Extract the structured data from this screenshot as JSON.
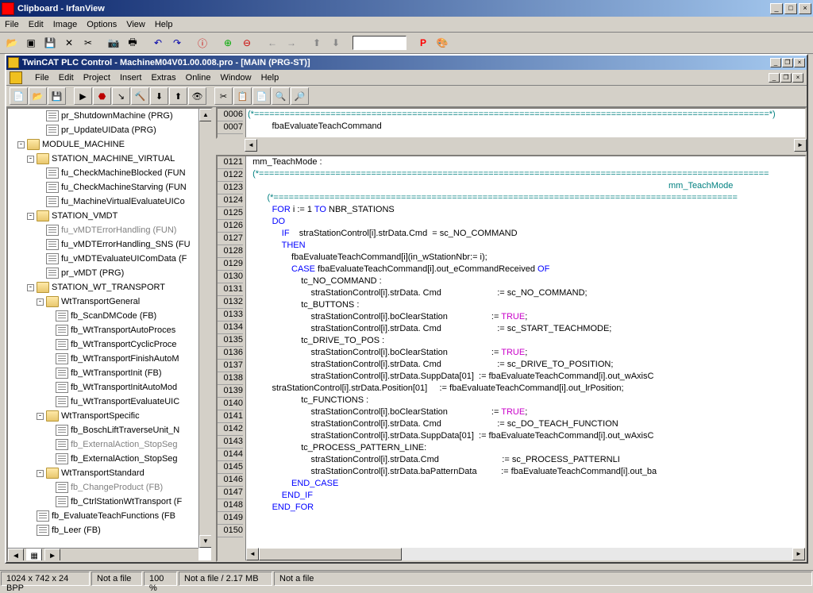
{
  "outer": {
    "title": "Clipboard - IrfanView",
    "menu": [
      "File",
      "Edit",
      "Image",
      "Options",
      "View",
      "Help"
    ]
  },
  "inner": {
    "title": "TwinCAT PLC Control - MachineM04V01.00.008.pro - [MAIN (PRG-ST)]",
    "menu": [
      "File",
      "Edit",
      "Project",
      "Insert",
      "Extras",
      "Online",
      "Window",
      "Help"
    ]
  },
  "tree": [
    {
      "ind": 3,
      "icon": "doc",
      "label": "pr_ShutdownMachine (PRG)"
    },
    {
      "ind": 3,
      "icon": "doc",
      "label": "pr_UpdateUIData (PRG)"
    },
    {
      "ind": 1,
      "exp": "-",
      "icon": "folder-open",
      "label": "MODULE_MACHINE"
    },
    {
      "ind": 2,
      "exp": "-",
      "icon": "folder-open",
      "label": "STATION_MACHINE_VIRTUAL"
    },
    {
      "ind": 3,
      "icon": "doc",
      "label": "fu_CheckMachineBlocked (FUN"
    },
    {
      "ind": 3,
      "icon": "doc",
      "label": "fu_CheckMachineStarving (FUN"
    },
    {
      "ind": 3,
      "icon": "doc",
      "label": "fu_MachineVirtualEvaluateUICo"
    },
    {
      "ind": 2,
      "exp": "-",
      "icon": "folder-open",
      "label": "STATION_VMDT"
    },
    {
      "ind": 3,
      "icon": "doc",
      "label": "fu_vMDTErrorHandling (FUN)",
      "dim": true
    },
    {
      "ind": 3,
      "icon": "doc",
      "label": "fu_vMDTErrorHandling_SNS (FU"
    },
    {
      "ind": 3,
      "icon": "doc",
      "label": "fu_vMDTEvaluateUIComData (F"
    },
    {
      "ind": 3,
      "icon": "doc",
      "label": "pr_vMDT (PRG)"
    },
    {
      "ind": 2,
      "exp": "-",
      "icon": "folder-open",
      "label": "STATION_WT_TRANSPORT"
    },
    {
      "ind": 3,
      "exp": "-",
      "icon": "folder-open",
      "label": "WtTransportGeneral"
    },
    {
      "ind": 4,
      "icon": "doc",
      "label": "fb_ScanDMCode (FB)"
    },
    {
      "ind": 4,
      "icon": "doc",
      "label": "fb_WtTransportAutoProces"
    },
    {
      "ind": 4,
      "icon": "doc",
      "label": "fb_WtTransportCyclicProce"
    },
    {
      "ind": 4,
      "icon": "doc",
      "label": "fb_WtTransportFinishAutoM"
    },
    {
      "ind": 4,
      "icon": "doc",
      "label": "fb_WtTransportInit (FB)"
    },
    {
      "ind": 4,
      "icon": "doc",
      "label": "fb_WtTransportInitAutoMod"
    },
    {
      "ind": 4,
      "icon": "doc",
      "label": "fu_WtTransportEvaluateUIC"
    },
    {
      "ind": 3,
      "exp": "-",
      "icon": "folder-open",
      "label": "WtTransportSpecific"
    },
    {
      "ind": 4,
      "icon": "doc",
      "label": "fb_BoschLiftTraverseUnit_N"
    },
    {
      "ind": 4,
      "icon": "doc",
      "label": "fb_ExternalAction_StopSeg",
      "dim": true
    },
    {
      "ind": 4,
      "icon": "doc",
      "label": "fb_ExternalAction_StopSeg"
    },
    {
      "ind": 3,
      "exp": "-",
      "icon": "folder-open",
      "label": "WtTransportStandard"
    },
    {
      "ind": 4,
      "icon": "doc",
      "label": "fb_ChangeProduct (FB)",
      "dim": true
    },
    {
      "ind": 4,
      "icon": "doc",
      "label": "fb_CtrlStationWtTransport (F"
    },
    {
      "ind": 2,
      "icon": "doc",
      "label": "fb_EvaluateTeachFunctions (FB"
    },
    {
      "ind": 2,
      "icon": "doc",
      "label": "fb_Leer (FB)"
    }
  ],
  "code_top": {
    "gutter": [
      "0006",
      "0007"
    ],
    "lines": [
      {
        "t": "(*=====================================================================================================*)",
        "cls": "teal"
      },
      {
        "t": "          fbaEvaluateTeachCommand"
      }
    ]
  },
  "code_main": {
    "gutter": [
      "0121",
      "0122",
      "0123",
      "0124",
      "0125",
      "0126",
      "0127",
      "0128",
      "0129",
      "0130",
      "0131",
      "0132",
      "0133",
      "0134",
      "0135",
      "0136",
      "0137",
      "0138",
      "0139",
      "0140",
      "0141",
      "0142",
      "0143",
      "0144",
      "0145",
      "0146",
      "0147",
      "0148",
      "0149",
      "0150"
    ],
    "label": "mm_TeachMode",
    "right_label": "mm_TeachMode"
  },
  "status": {
    "s1": "1024 x 742 x 24 BPP",
    "s2": "Not a file",
    "s3": "100 %",
    "s4": "Not a file / 2.17 MB",
    "s5": "Not a file"
  }
}
